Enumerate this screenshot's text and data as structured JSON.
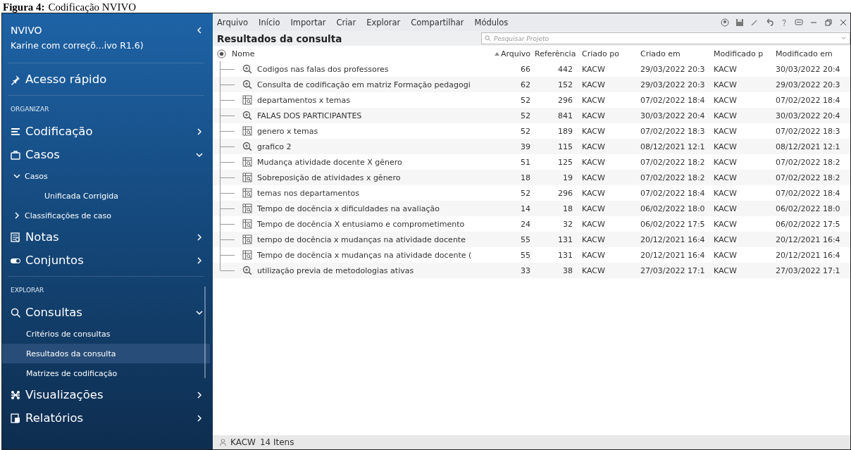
{
  "caption": {
    "label": "Figura 4:",
    "text": "Codificação NVIVO"
  },
  "sidebar": {
    "app_name": "NVIVO",
    "project": "Karine com correçõ...ivo R1.6)",
    "items": [
      {
        "kind": "divider"
      },
      {
        "kind": "nav",
        "label": "Acesso rápido"
      },
      {
        "kind": "divider"
      },
      {
        "kind": "section",
        "label": "ORGANIZAR"
      },
      {
        "kind": "nav",
        "label": "Codificação",
        "expanded": false
      },
      {
        "kind": "nav",
        "label": "Casos",
        "expanded": true
      },
      {
        "kind": "group",
        "label": "Casos",
        "expanded": true
      },
      {
        "kind": "sub",
        "label": "Unificada Corrigida",
        "selected": false
      },
      {
        "kind": "group",
        "label": "Classificações de caso",
        "expanded": false
      },
      {
        "kind": "nav",
        "label": "Notas",
        "expanded": false
      },
      {
        "kind": "nav",
        "label": "Conjuntos",
        "expanded": false
      },
      {
        "kind": "divider"
      },
      {
        "kind": "section",
        "label": "EXPLORAR"
      },
      {
        "kind": "nav",
        "label": "Consultas",
        "expanded": true
      },
      {
        "kind": "sub",
        "label": "Critérios de consultas",
        "selected": false
      },
      {
        "kind": "sub",
        "label": "Resultados da consulta",
        "selected": true
      },
      {
        "kind": "sub",
        "label": "Matrizes de codificação",
        "selected": false
      },
      {
        "kind": "nav",
        "label": "Visualizações",
        "expanded": false
      },
      {
        "kind": "nav",
        "label": "Relatórios",
        "expanded": false
      }
    ]
  },
  "menu": [
    "Arquivo",
    "Início",
    "Importar",
    "Criar",
    "Explorar",
    "Compartilhar",
    "Módulos"
  ],
  "title": "Resultados da consulta",
  "search": {
    "placeholder": "Pesquisar Projeto"
  },
  "table": {
    "columns": [
      "Nome",
      "Arquivo",
      "Referência",
      "Criado po",
      "Criado em",
      "Modificado p",
      "Modificado em"
    ],
    "rows": [
      {
        "kind": "query",
        "cells": [
          "Codigos nas falas dos professores",
          "66",
          "442",
          "KACW",
          "29/03/2022 20:3",
          "KACW",
          "30/03/2022 20:4"
        ]
      },
      {
        "kind": "query",
        "cells": [
          "Consulta de codificação em matriz Formação pedagogi",
          "62",
          "152",
          "KACW",
          "29/03/2022 20:3",
          "KACW",
          "29/03/2022 20:3"
        ]
      },
      {
        "kind": "matrix",
        "cells": [
          "departamentos x temas",
          "52",
          "296",
          "KACW",
          "07/02/2022 18:4",
          "KACW",
          "07/02/2022 18:4"
        ]
      },
      {
        "kind": "query",
        "cells": [
          "FALAS DOS PARTICIPANTES",
          "52",
          "841",
          "KACW",
          "30/03/2022 20:4",
          "KACW",
          "30/03/2022 20:4"
        ]
      },
      {
        "kind": "matrix",
        "cells": [
          "genero x temas",
          "52",
          "189",
          "KACW",
          "07/02/2022 18:3",
          "KACW",
          "07/02/2022 18:3"
        ]
      },
      {
        "kind": "query",
        "cells": [
          "grafico 2",
          "39",
          "115",
          "KACW",
          "08/12/2021 12:1",
          "KACW",
          "08/12/2021 12:1"
        ]
      },
      {
        "kind": "matrix",
        "cells": [
          "Mudança atividade docente X gênero",
          "51",
          "125",
          "KACW",
          "07/02/2022 18:2",
          "KACW",
          "07/02/2022 18:2"
        ]
      },
      {
        "kind": "matrix",
        "cells": [
          "Sobreposição de atividades x gênero",
          "18",
          "19",
          "KACW",
          "07/02/2022 18:2",
          "KACW",
          "07/02/2022 18:2"
        ]
      },
      {
        "kind": "matrix",
        "cells": [
          "temas nos departamentos",
          "52",
          "296",
          "KACW",
          "07/02/2022 18:4",
          "KACW",
          "07/02/2022 18:4"
        ]
      },
      {
        "kind": "matrix",
        "cells": [
          "Tempo de docência x dificuldades na avaliação",
          "14",
          "18",
          "KACW",
          "06/02/2022 18:0",
          "KACW",
          "06/02/2022 18:0"
        ]
      },
      {
        "kind": "matrix",
        "cells": [
          "Tempo de docência X entusiamo e comprometimento",
          "24",
          "32",
          "KACW",
          "06/02/2022 17:5",
          "KACW",
          "06/02/2022 17:5"
        ]
      },
      {
        "kind": "matrix",
        "cells": [
          "tempo de docência x mudanças na atividade docente",
          "55",
          "131",
          "KACW",
          "20/12/2021 16:4",
          "KACW",
          "20/12/2021 16:4"
        ]
      },
      {
        "kind": "matrix",
        "cells": [
          "Tempo de docência x mudanças na atividade docente (",
          "55",
          "131",
          "KACW",
          "20/12/2021 16:4",
          "KACW",
          "20/12/2021 16:4"
        ]
      },
      {
        "kind": "query",
        "cells": [
          "utilização previa de metodologias ativas",
          "33",
          "38",
          "KACW",
          "27/03/2022 17:1",
          "KACW",
          "27/03/2022 17:1"
        ]
      }
    ]
  },
  "status_bar": {
    "user": "KACW",
    "count": "14 Itens"
  }
}
